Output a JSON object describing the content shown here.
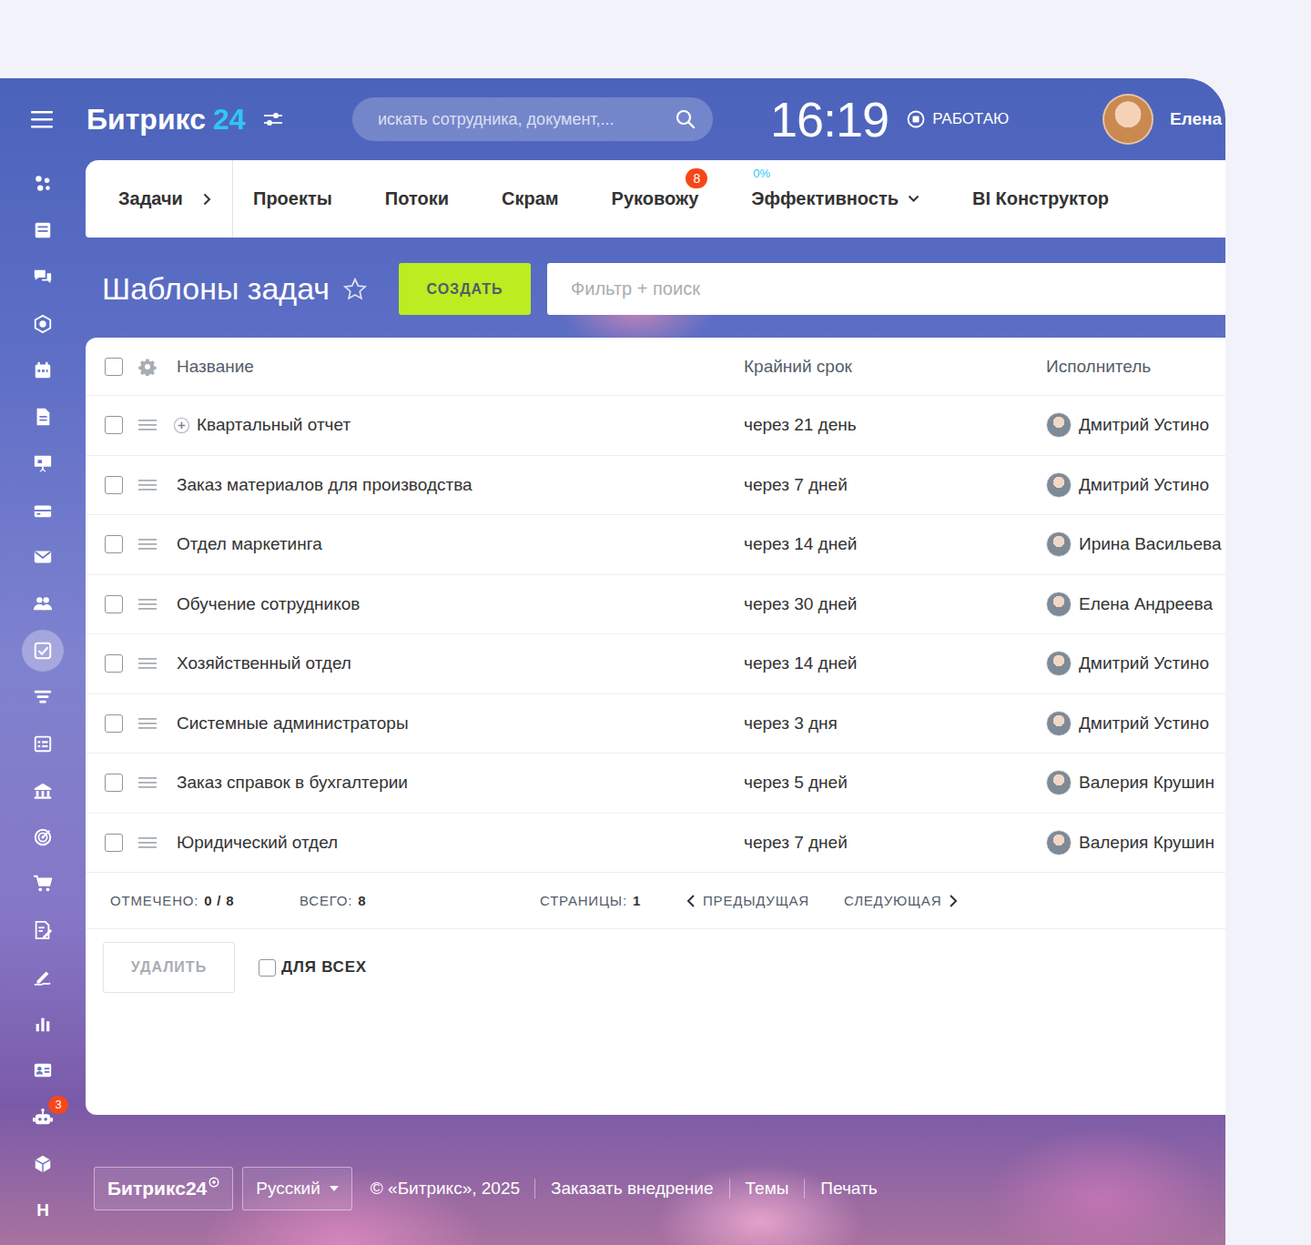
{
  "header": {
    "logo": {
      "text": "Битрикс",
      "number": "24"
    },
    "search": {
      "placeholder": "искать сотрудника, документ,..."
    },
    "clock": "16:19",
    "work_status": {
      "label": "РАБОТАЮ"
    },
    "user": {
      "name": "Елена"
    }
  },
  "sidebar": {
    "items": [
      {
        "selected": false
      },
      {
        "selected": false
      },
      {
        "selected": false
      },
      {
        "selected": false
      },
      {
        "selected": false
      },
      {
        "selected": false
      },
      {
        "selected": false
      },
      {
        "selected": false
      },
      {
        "selected": false
      },
      {
        "selected": false
      },
      {
        "selected": true
      },
      {
        "selected": false
      },
      {
        "selected": false
      },
      {
        "selected": false
      },
      {
        "selected": false
      },
      {
        "selected": false
      },
      {
        "selected": false
      },
      {
        "selected": false
      },
      {
        "selected": false
      },
      {
        "selected": false
      },
      {
        "selected": false,
        "badge": "3"
      },
      {
        "selected": false
      }
    ],
    "letter": "Н"
  },
  "nav": {
    "tabs": [
      {
        "label": "Задачи",
        "selected": false,
        "kind": "root"
      },
      {
        "label": "Проекты",
        "selected": false,
        "kind": "plain"
      },
      {
        "label": "Потоки",
        "selected": false,
        "kind": "plain"
      },
      {
        "label": "Скрам",
        "selected": false,
        "kind": "plain"
      },
      {
        "label": "Руковожу",
        "selected": false,
        "kind": "badge",
        "badge": "8"
      },
      {
        "label": "Эффективность",
        "selected": false,
        "kind": "dropdown",
        "counter": "0%"
      },
      {
        "label": "BI Конструктор",
        "selected": false,
        "kind": "plain"
      }
    ]
  },
  "page": {
    "title": "Шаблоны задач",
    "favorite": false,
    "create_button": "СОЗДАТЬ",
    "filter": {
      "placeholder": "Фильтр + поиск"
    }
  },
  "table": {
    "all_checked": false,
    "columns": [
      "Название",
      "Крайний срок",
      "Исполнитель"
    ],
    "rows": [
      {
        "name": "Квартальный отчет",
        "deadline": "через 21 день",
        "assignee": "Дмитрий Устино",
        "checked": false,
        "expandable": true
      },
      {
        "name": "Заказ материалов для производства",
        "deadline": "через 7 дней",
        "assignee": "Дмитрий Устино",
        "checked": false,
        "expandable": false
      },
      {
        "name": "Отдел маркетинга",
        "deadline": "через 14 дней",
        "assignee": "Ирина Васильева",
        "checked": false,
        "expandable": false
      },
      {
        "name": "Обучение сотрудников",
        "deadline": "через 30 дней",
        "assignee": "Елена Андреева",
        "checked": false,
        "expandable": false
      },
      {
        "name": "Хозяйственный отдел",
        "deadline": "через 14 дней",
        "assignee": "Дмитрий Устино",
        "checked": false,
        "expandable": false
      },
      {
        "name": "Системные администраторы",
        "deadline": "через 3 дня",
        "assignee": "Дмитрий Устино",
        "checked": false,
        "expandable": false
      },
      {
        "name": "Заказ справок в бухгалтерии",
        "deadline": "через 5 дней",
        "assignee": "Валерия Крушин",
        "checked": false,
        "expandable": false
      },
      {
        "name": "Юридический отдел",
        "deadline": "через 7 дней",
        "assignee": "Валерия Крушин",
        "checked": false,
        "expandable": false
      }
    ]
  },
  "status_bar": {
    "checked_label": "ОТМЕЧЕНО:",
    "checked_value": "0 / 8",
    "total_label": "ВСЕГО:",
    "total_value": "8",
    "pages_label": "СТРАНИЦЫ:",
    "pages_value": "1",
    "prev": "ПРЕДЫДУЩАЯ",
    "next": "СЛЕДУЮЩАЯ"
  },
  "actions": {
    "delete": {
      "label": "УДАЛИТЬ",
      "disabled": true
    },
    "for_all": {
      "label": "ДЛЯ ВСЕХ",
      "checked": false
    }
  },
  "footer": {
    "brand": "Битрикс24",
    "language": "Русский",
    "copyright": "© «Битрикс», 2025",
    "links": [
      "Заказать внедрение",
      "Темы",
      "Печать"
    ]
  }
}
